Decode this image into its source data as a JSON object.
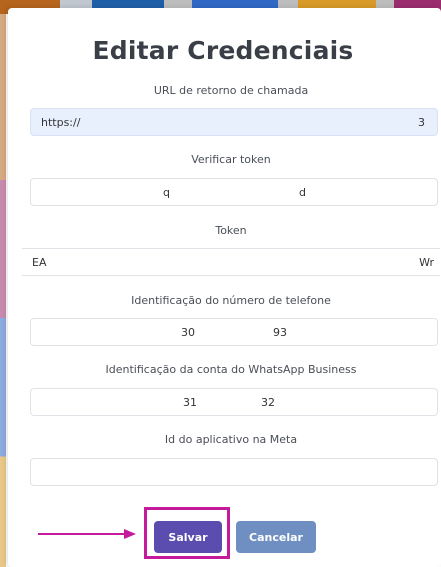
{
  "dialog": {
    "title": "Editar Credenciais"
  },
  "fields": [
    {
      "label": "URL de retorno de chamada",
      "value_start": "https://",
      "value_end": "3"
    },
    {
      "label": "Verificar token",
      "value_start": "q",
      "value_end": "d"
    },
    {
      "label": "Token",
      "value_start": "EA",
      "value_end": "Wr"
    },
    {
      "label": "Identificação do número de telefone",
      "value_start": "30",
      "value_end": "93"
    },
    {
      "label": "Identificação da conta do WhatsApp Business",
      "value_start": "31",
      "value_end": "32"
    },
    {
      "label": "Id do aplicativo na Meta",
      "value_start": "",
      "value_end": ""
    }
  ],
  "buttons": {
    "save_label": "Salvar",
    "cancel_label": "Cancelar"
  },
  "annotation": {
    "highlight_color": "#c51a9b"
  },
  "colors": {
    "save_button": "#5b4cb0",
    "cancel_button": "#6f8fc2",
    "autofill_background": "#e8f0fe"
  }
}
